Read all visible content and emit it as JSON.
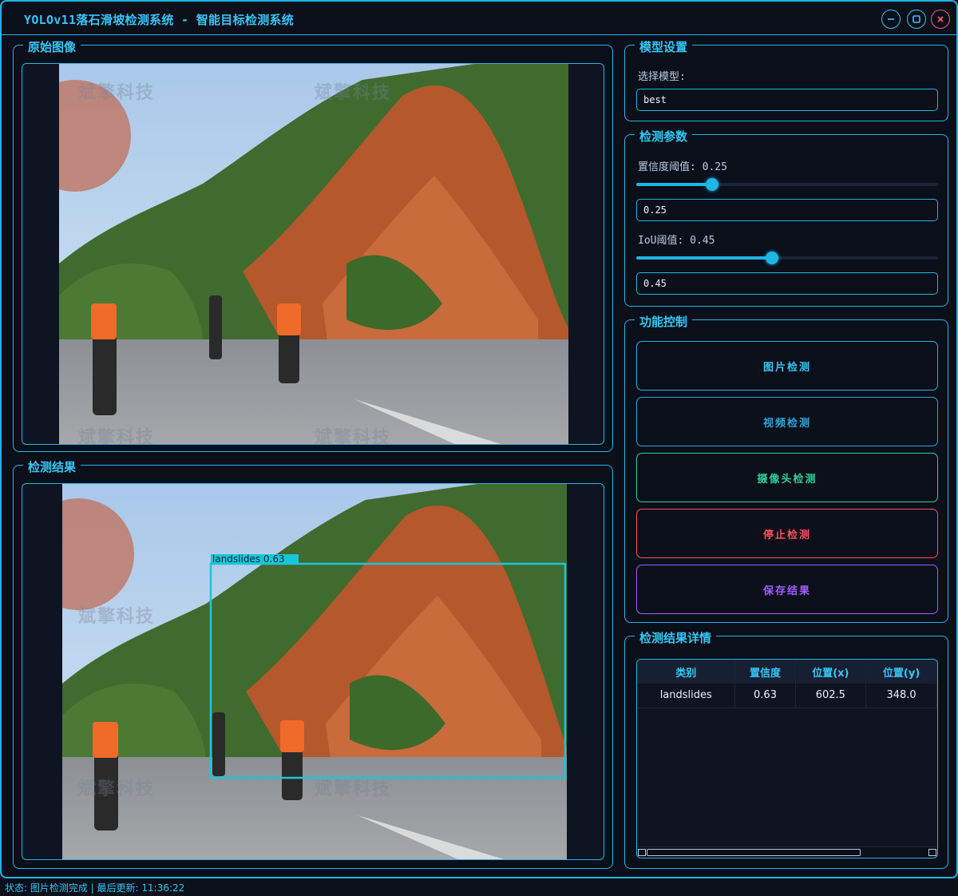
{
  "window": {
    "title": "YOLOv11落石滑坡检测系统 - 智能目标检测系统"
  },
  "panels": {
    "original": {
      "title": "原始图像"
    },
    "result": {
      "title": "检测结果"
    },
    "model": {
      "title": "模型设置",
      "select_label": "选择模型:",
      "select_value": "best"
    },
    "params": {
      "title": "检测参数",
      "conf_label": "置信度阈值: 0.25",
      "conf_value": "0.25",
      "conf_level": 0.25,
      "iou_label": "IoU阈值: 0.45",
      "iou_value": "0.45",
      "iou_level": 0.45
    },
    "controls": {
      "title": "功能控制",
      "image_detect": "图片检测",
      "video_detect": "视频检测",
      "camera_detect": "摄像头检测",
      "stop_detect": "停止检测",
      "save_result": "保存结果"
    },
    "details": {
      "title": "检测结果详情",
      "columns": [
        "类别",
        "置信度",
        "位置(x)",
        "位置(y)"
      ],
      "rows": [
        [
          "landslides",
          "0.63",
          "602.5",
          "348.0"
        ]
      ]
    }
  },
  "detection": {
    "label": "landslides 0.63"
  },
  "watermark": "斌擎科技",
  "status": "状态: 图片检测完成 | 最后更新: 11:36:22",
  "colors": {
    "accent": "#1fb6e6",
    "video": "#2aa6d8",
    "camera": "#2ecf9a",
    "stop": "#ff4d5e",
    "save": "#a35cff"
  }
}
